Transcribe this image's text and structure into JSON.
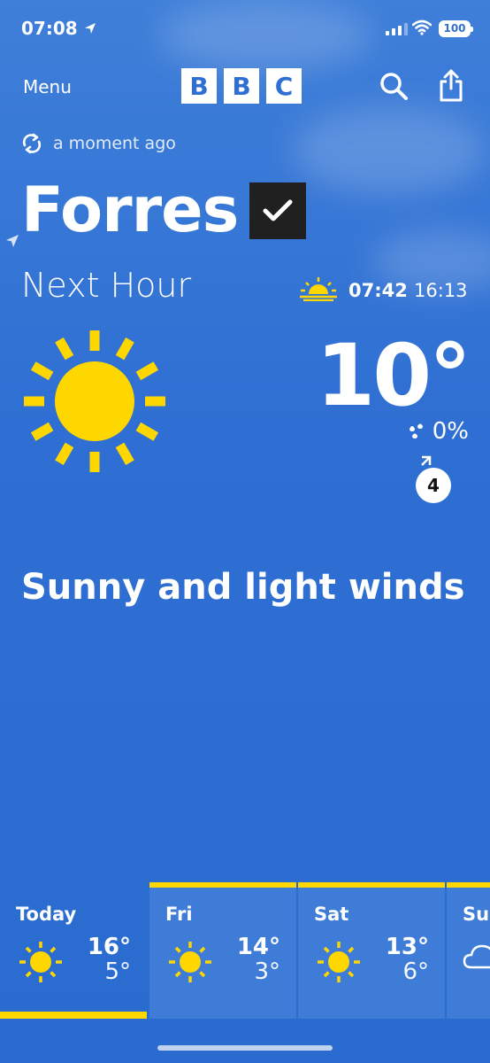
{
  "status_bar": {
    "time": "07:08",
    "battery": "100"
  },
  "header": {
    "menu_label": "Menu",
    "logo_letters": [
      "B",
      "B",
      "C"
    ]
  },
  "refresh": {
    "text": "a moment ago"
  },
  "location": {
    "name": "Forres"
  },
  "current": {
    "period": "Next Hour",
    "sunrise": "07:42",
    "sunset": "16:13",
    "temperature": "10°",
    "rain_chance": "0%",
    "wind_speed": "4",
    "summary": "Sunny and light winds"
  },
  "forecast": [
    {
      "day": "Today",
      "high": "16°",
      "low": "5°",
      "icon": "sun-icon"
    },
    {
      "day": "Fri",
      "high": "14°",
      "low": "3°",
      "icon": "sun-icon"
    },
    {
      "day": "Sat",
      "high": "13°",
      "low": "6°",
      "icon": "sun-icon"
    },
    {
      "day": "Su",
      "icon": "cloud-icon"
    }
  ],
  "colors": {
    "accent": "#ffd700",
    "sky": "#2f6fd3"
  }
}
